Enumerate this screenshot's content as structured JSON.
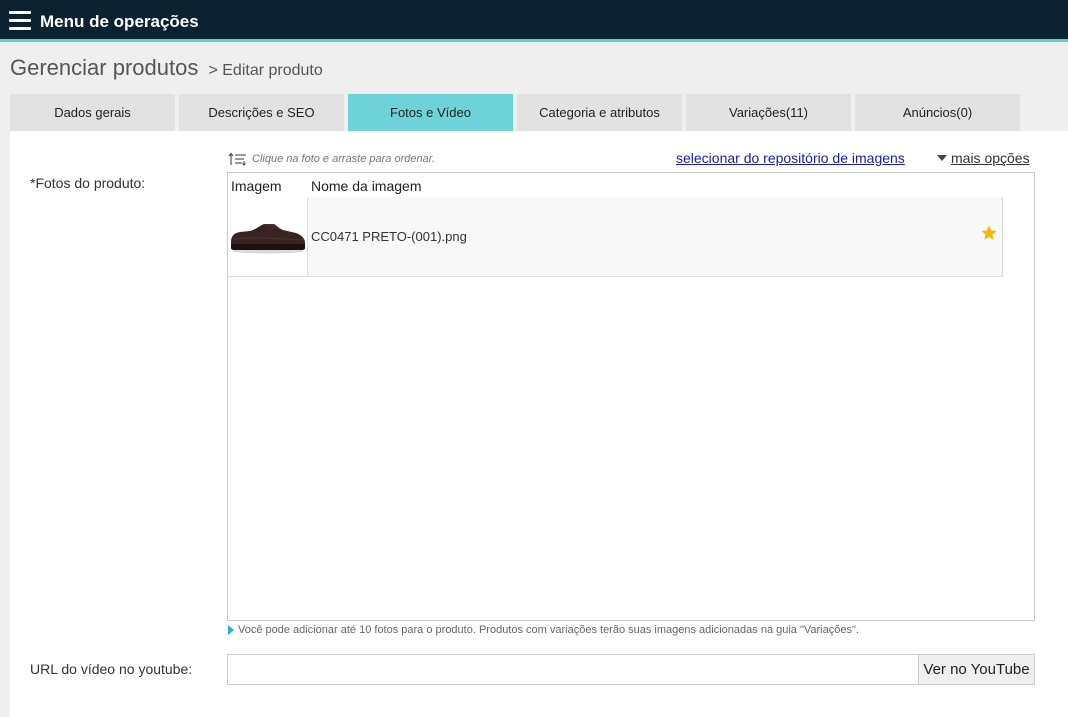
{
  "topbar": {
    "title": "Menu de operações"
  },
  "header": {
    "title": "Gerenciar produtos",
    "subtitle": "> Editar produto"
  },
  "tabs": [
    {
      "label": "Dados gerais"
    },
    {
      "label": "Descrições e SEO"
    },
    {
      "label": "Fotos e Vídeo",
      "active": true
    },
    {
      "label": "Categoria e atributos"
    },
    {
      "label": "Variações(11)"
    },
    {
      "label": "Anúncios(0)"
    }
  ],
  "photos": {
    "label": "*Fotos do produto:",
    "hint": "Clique na foto e arraste para ordenar.",
    "repo_link": "selecionar do repositório de imagens",
    "more_options": "mais opções",
    "columns": {
      "image": "Imagem",
      "name": "Nome da imagem"
    },
    "rows": [
      {
        "name": "CC0471 PRETO-(001).png",
        "main": true
      }
    ],
    "note": "Você pode adicionar até 10 fotos para o produto. Produtos com variações terão suas imagens adicionadas na guia \"Variações\"."
  },
  "video": {
    "label": "URL do vídeo no youtube:",
    "value": "",
    "button": "Ver no YouTube"
  },
  "colors": {
    "topbar": "#0c2230",
    "accent": "#6dd3d8",
    "link": "#1a1ab8",
    "star": "#f5b800"
  }
}
